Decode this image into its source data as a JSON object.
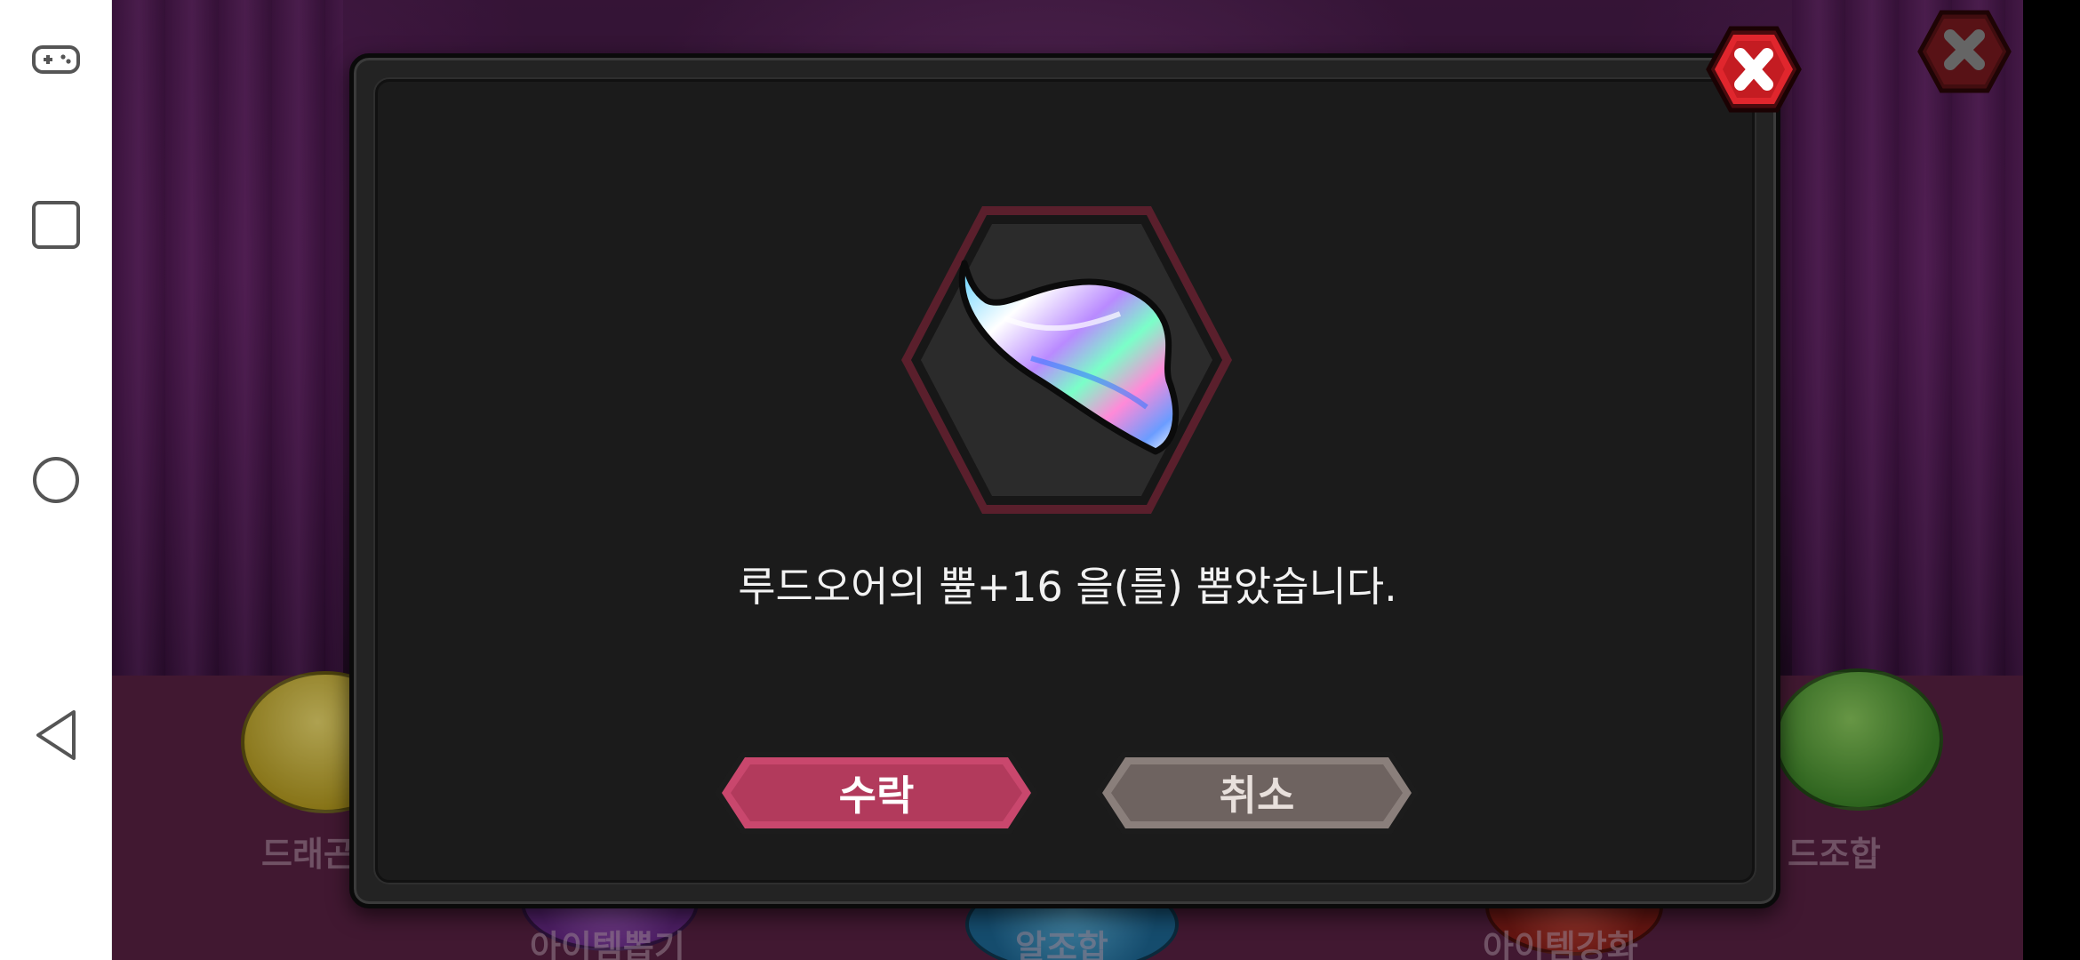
{
  "system_nav": {
    "items": [
      {
        "name": "game-mode",
        "icon": "gamepad-icon"
      },
      {
        "name": "recents",
        "icon": "square-icon"
      },
      {
        "name": "home",
        "icon": "circle-icon"
      },
      {
        "name": "back",
        "icon": "triangle-back-icon"
      }
    ]
  },
  "scene": {
    "menu_labels": {
      "dragon_left": "드래곤",
      "card_combine": "드조합",
      "item_draw": "아이템뽑기",
      "egg_combine": "알조합",
      "item_enhance": "아이템강화"
    },
    "close_icon": "close-x-icon"
  },
  "dialog": {
    "item_icon": "rainbow-horn-icon",
    "message": "루드오어의 뿔+16 을(를) 뽑았습니다.",
    "accept_label": "수락",
    "cancel_label": "취소",
    "close_icon": "close-x-icon"
  },
  "colors": {
    "accept_button": "#b83a5e",
    "cancel_button": "#6e6360",
    "close_button": "#d8232a",
    "dialog_bg": "#1b1b1b",
    "frame_border": "#5a1f2c"
  }
}
